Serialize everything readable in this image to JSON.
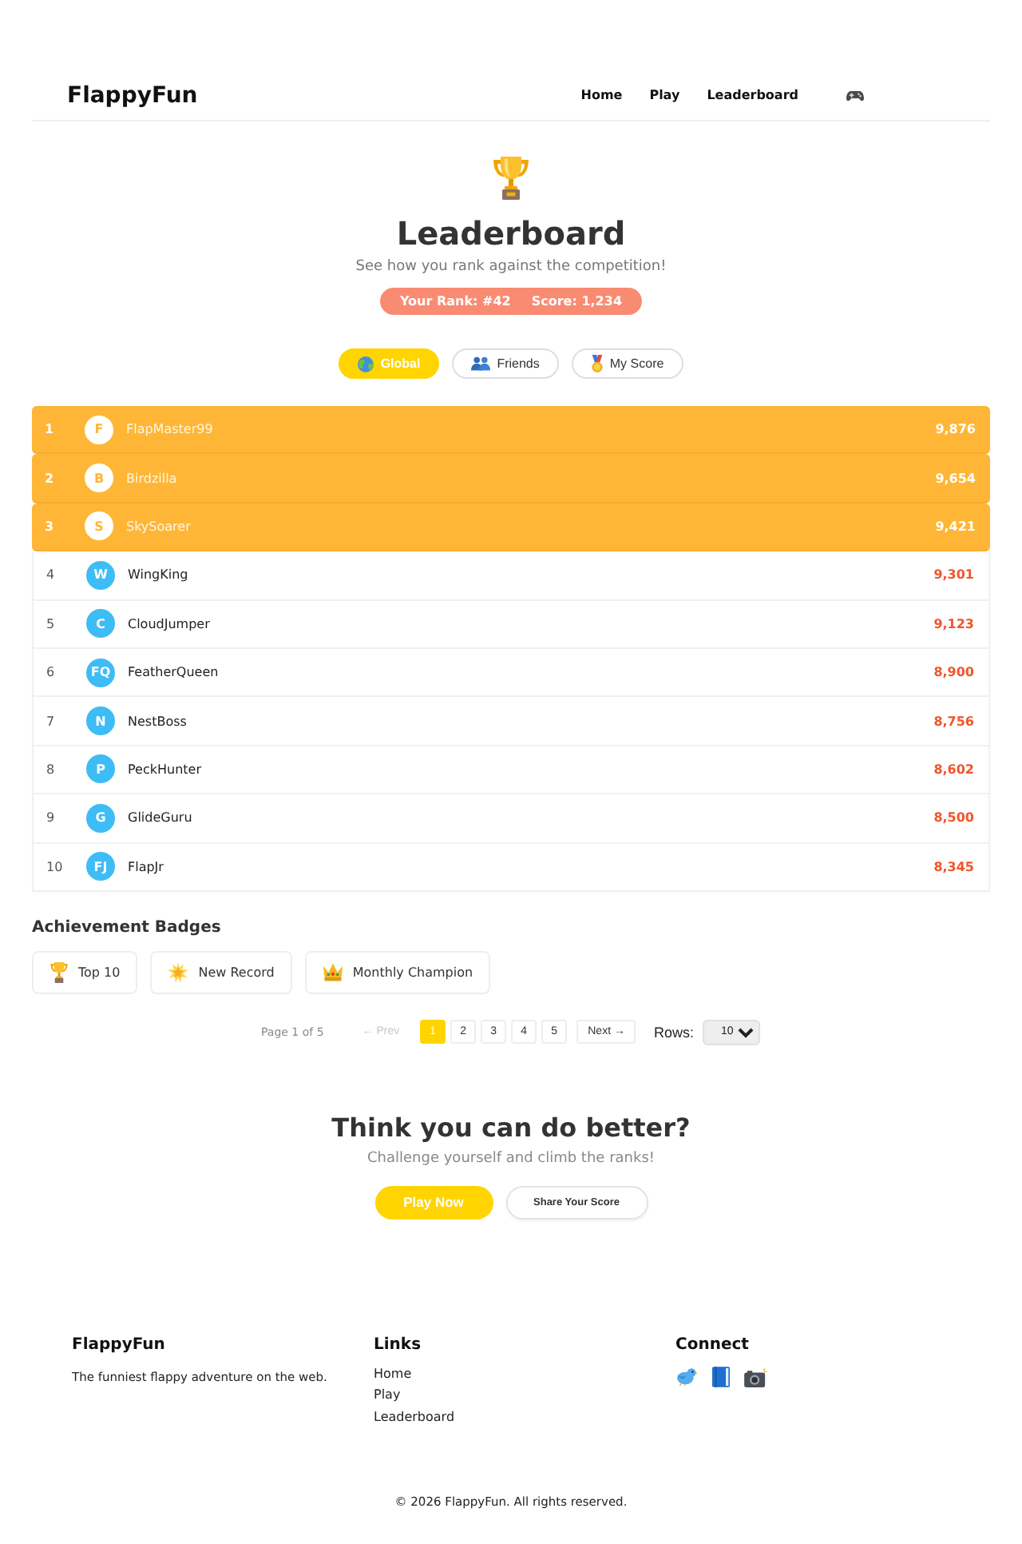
{
  "header": {
    "logo": "FlappyFun",
    "nav": [
      {
        "label": "Home"
      },
      {
        "label": "Play"
      },
      {
        "label": "Leaderboard"
      }
    ]
  },
  "hero": {
    "title": "Leaderboard",
    "subtitle": "See how you rank against the competition!",
    "rank": "Your Rank: #42",
    "score": "Score: 1,234"
  },
  "tabs": [
    {
      "label": "Global",
      "selected": true
    },
    {
      "label": "Friends",
      "selected": false
    },
    {
      "label": "My Score",
      "selected": false
    }
  ],
  "leaderboard": {
    "rows": [
      {
        "rank": "1",
        "initials": "F",
        "name": "FlapMaster99",
        "score": "9,876",
        "highlighted": true
      },
      {
        "rank": "2",
        "initials": "B",
        "name": "Birdzilla",
        "score": "9,654",
        "highlighted": true
      },
      {
        "rank": "3",
        "initials": "S",
        "name": "SkySoarer",
        "score": "9,421",
        "highlighted": true
      },
      {
        "rank": "4",
        "initials": "W",
        "name": "WingKing",
        "score": "9,301",
        "highlighted": false
      },
      {
        "rank": "5",
        "initials": "C",
        "name": "CloudJumper",
        "score": "9,123",
        "highlighted": false
      },
      {
        "rank": "6",
        "initials": "FQ",
        "name": "FeatherQueen",
        "score": "8,900",
        "highlighted": false
      },
      {
        "rank": "7",
        "initials": "N",
        "name": "NestBoss",
        "score": "8,756",
        "highlighted": false
      },
      {
        "rank": "8",
        "initials": "P",
        "name": "PeckHunter",
        "score": "8,602",
        "highlighted": false
      },
      {
        "rank": "9",
        "initials": "G",
        "name": "GlideGuru",
        "score": "8,500",
        "highlighted": false
      },
      {
        "rank": "10",
        "initials": "FJ",
        "name": "FlapJr",
        "score": "8,345",
        "highlighted": false
      }
    ]
  },
  "badges": {
    "title": "Achievement Badges",
    "items": [
      {
        "label": "Top 10"
      },
      {
        "label": "New Record"
      },
      {
        "label": "Monthly Champion"
      }
    ]
  },
  "pagination": {
    "summary": "Page 1 of 5",
    "prev": {
      "label": "← Prev",
      "disabled": true
    },
    "pages": [
      {
        "label": "1",
        "selected": true
      },
      {
        "label": "2",
        "selected": false
      },
      {
        "label": "3",
        "selected": false
      },
      {
        "label": "4",
        "selected": false
      },
      {
        "label": "5",
        "selected": false
      }
    ],
    "next": {
      "label": "Next →",
      "disabled": false
    },
    "rows_label": "Rows:",
    "rows_value": "10"
  },
  "cta": {
    "title": "Think you can do better?",
    "subtitle": "Challenge yourself and climb the ranks!",
    "buttons": [
      {
        "label": "Play Now",
        "kind": "primary"
      },
      {
        "label": "Share Your Score",
        "kind": "secondary"
      }
    ]
  },
  "footer": {
    "columns": [
      {
        "kind": "text",
        "title": "FlappyFun",
        "text": "The funniest flappy adventure on the web."
      },
      {
        "kind": "links",
        "title": "Links",
        "links": [
          "Home",
          "Play",
          "Leaderboard"
        ]
      },
      {
        "kind": "social",
        "title": "Connect"
      }
    ],
    "copyright": "© 2026 FlappyFun. All rights reserved."
  }
}
